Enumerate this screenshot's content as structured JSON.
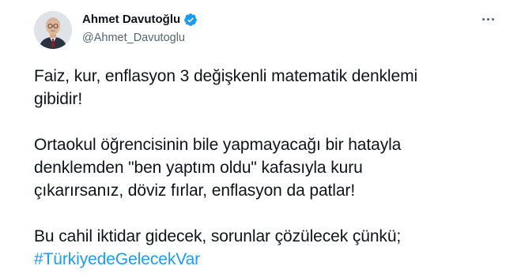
{
  "tweet": {
    "author": {
      "display_name": "Ahmet Davutoğlu",
      "handle": "@Ahmet_Davutoglu",
      "verified_icon": "verified-badge-icon"
    },
    "more_icon": "more-options-icon",
    "paragraphs": [
      {
        "lines": [
          "Faiz, kur, enflasyon 3 değişkenli matematik denklemi",
          "gibidir!"
        ]
      },
      {
        "lines": [
          "Ortaokul öğrencisinin bile yapmayacağı bir hatayla",
          "denklemden \"ben yaptım oldu\" kafasıyla kuru",
          "çıkarırsanız, döviz fırlar, enflasyon da patlar!"
        ]
      },
      {
        "lines": [
          "Bu cahil iktidar gidecek, sorunlar çözülecek çünkü;"
        ],
        "hashtag": "#TürkiyedeGelecekVar"
      }
    ],
    "colors": {
      "text": "#0f1419",
      "secondary": "#536471",
      "link": "#1d9bf0",
      "verified": "#1d9bf0"
    }
  }
}
